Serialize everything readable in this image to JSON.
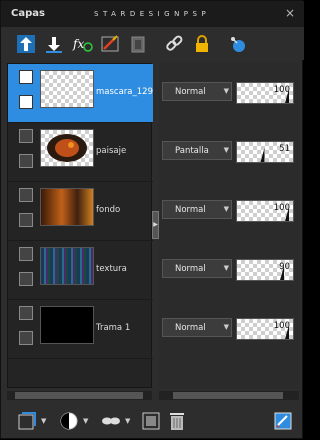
{
  "panel": {
    "title": "Capas",
    "watermark": "STARDESIGNPSP",
    "close": "×"
  },
  "toolbar": {
    "icons": [
      "new-raster-layer-icon",
      "new-vector-layer-icon",
      "fx-effects-icon",
      "brush-layer-icon",
      "mask-icon",
      "link-icon",
      "lock-icon",
      "visibility-toggle-icon"
    ]
  },
  "layers": [
    {
      "name": "mascara_129",
      "selected": true,
      "thumb": "checker",
      "blend": "Normal",
      "opacity": "100",
      "opacity_pct": 100
    },
    {
      "name": "paisaje",
      "selected": false,
      "thumb": "paisaje",
      "blend": "Pantalla",
      "opacity": "51",
      "opacity_pct": 51
    },
    {
      "name": "fondo",
      "selected": false,
      "thumb": "fondo",
      "blend": "Normal",
      "opacity": "100",
      "opacity_pct": 100
    },
    {
      "name": "textura",
      "selected": false,
      "thumb": "textura",
      "blend": "Normal",
      "opacity": "90",
      "opacity_pct": 90
    },
    {
      "name": "Trama 1",
      "selected": false,
      "thumb": "black",
      "blend": "Normal",
      "opacity": "100",
      "opacity_pct": 100
    }
  ],
  "colors": {
    "selection": "#2e8de0",
    "panel_bg": "#2d2d2d",
    "title_bg": "#1b1b1b"
  },
  "bottom_icons": [
    "layer-mask-icon",
    "adjust-layer-icon",
    "mask-glasses-icon",
    "merge-layer-icon",
    "delete-icon",
    "edit-layer-icon"
  ]
}
